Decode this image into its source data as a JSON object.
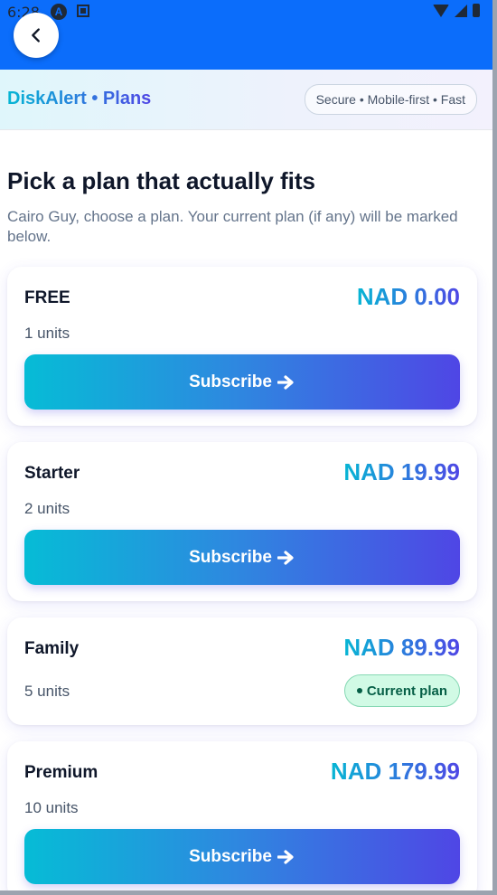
{
  "status_bar": {
    "time": "6:28",
    "icon_a_label": "A"
  },
  "header": {
    "brand": "DiskAlert • Plans",
    "tagline": "Secure • Mobile-first • Fast"
  },
  "main": {
    "title": "Pick a plan that actually fits",
    "subtitle": "Cairo Guy, choose a plan. Your current plan (if any) will be marked below."
  },
  "plans": [
    {
      "name": "FREE",
      "price": "NAD 0.00",
      "units": "1 units",
      "action": "Subscribe"
    },
    {
      "name": "Starter",
      "price": "NAD 19.99",
      "units": "2 units",
      "action": "Subscribe"
    },
    {
      "name": "Family",
      "price": "NAD 89.99",
      "units": "5 units",
      "badge": "Current plan"
    },
    {
      "name": "Premium",
      "price": "NAD 179.99",
      "units": "10 units",
      "action": "Subscribe"
    }
  ],
  "icons": {
    "back": "chevron-left-icon",
    "arrow": "arrow-right-icon",
    "wifi": "wifi-icon",
    "signal": "signal-icon",
    "battery": "battery-icon"
  },
  "colors": {
    "topbar": "#0b6dfb",
    "accent_start": "#06b6d4",
    "accent_end": "#4f46e5",
    "badge_bg": "#d1fae5",
    "badge_text": "#065f46"
  }
}
